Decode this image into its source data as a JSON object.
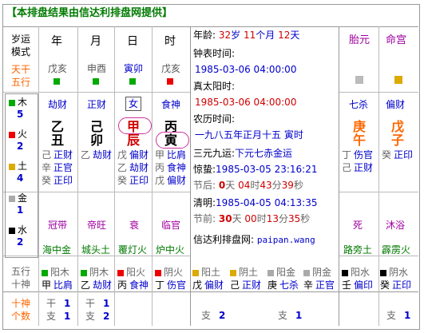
{
  "header": {
    "title": "【本排盘结果由信达利排盘网提供】"
  },
  "row_labels": {
    "yun": "岁运模式",
    "tiangan": "天干五行",
    "wuxing": [
      {
        "name": "木",
        "count": "5",
        "color": "#00aa00"
      },
      {
        "name": "火",
        "count": "2",
        "color": "#ee0000"
      },
      {
        "name": "土",
        "count": "4",
        "color": "#ddaa00"
      },
      {
        "name": "金",
        "count": "1",
        "color": "#aaaaaa"
      },
      {
        "name": "水",
        "count": "2",
        "color": "#000000"
      }
    ],
    "wuxing_shishen": "五行十神",
    "shishen_count": "十神个数"
  },
  "pillars": [
    {
      "header": "年",
      "ganzhi": "戊亥",
      "color": "#00aa00",
      "shishen": "劫财",
      "gan": "乙",
      "zhi": "丑",
      "cang": [
        [
          "己",
          "正财"
        ],
        [
          "辛",
          "正官"
        ],
        [
          "癸",
          "正印"
        ]
      ],
      "state": "冠带",
      "nayin": "海中金",
      "wx_sq": "#00aa00",
      "wx_text": "阳木",
      "wx_ss": "比肩",
      "count": [
        "干",
        "1",
        "支",
        "1"
      ]
    },
    {
      "header": "月",
      "ganzhi": "申酉",
      "color": "#00aa00",
      "shishen": "正财",
      "gan": "己",
      "zhi": "卯",
      "cang": [
        [
          "乙",
          "劫财"
        ]
      ],
      "state": "帝旺",
      "nayin": "城头土",
      "wx_sq": "#00aa00",
      "wx_text": "阴木",
      "wx_ss": "劫财",
      "count": [
        "干",
        "1",
        "支",
        "2"
      ]
    },
    {
      "header": "日",
      "ganzhi": "寅卯",
      "color": "#00aa00",
      "shishen": "女",
      "gan": "甲",
      "zhi": "辰",
      "cang": [
        [
          "戊",
          "偏财"
        ],
        [
          "乙",
          "劫财"
        ],
        [
          "癸",
          "正印"
        ]
      ],
      "state": "衰",
      "nayin": "覆灯火",
      "wx_sq": "#ee0000",
      "wx_text": "阳火",
      "wx_ss": "食神",
      "count": [
        "干",
        "",
        "",
        " "
      ]
    },
    {
      "header": "时",
      "ganzhi": "戊亥",
      "color": "#ee0000",
      "shishen": "食神",
      "gan": "丙",
      "zhi": "寅",
      "cang": [
        [
          "甲",
          "比肩"
        ],
        [
          "丙",
          "食神"
        ],
        [
          "戊",
          "偏财"
        ]
      ],
      "state": "临官",
      "nayin": "炉中火",
      "wx_sq": "#ee0000",
      "wx_text": "阴火",
      "wx_ss": "伤官",
      "count": [
        "干",
        "",
        "",
        " "
      ]
    }
  ],
  "info": {
    "age_label": "年龄:",
    "age_year": "32",
    "age_year_unit": "岁",
    "age_month": "11",
    "age_month_unit": "个月",
    "age_day": "12",
    "age_day_unit": "天",
    "clock_label": "钟表时间:",
    "clock_value": "1985-03-06 04:00:00",
    "solar_label": "真太阳时:",
    "solar_value": "1985-03-06 04:00:00",
    "lunar_label": "农历时间:",
    "lunar_value": "一九八五年正月十五 寅时",
    "sanyuan_label": "三元九运:",
    "sanyuan_value": "下元七赤金运",
    "jingzhe_label": "惊蛰:",
    "jingzhe_value": "1985-03-05 23:16:21",
    "jieqian_label": "节后:",
    "jieqian_d": "0",
    "jieqian_d_unit": "天",
    "jieqian_h": "04",
    "jieqian_h_unit": "时",
    "jieqian_m": "43",
    "jieqian_m_unit": "分",
    "jieqian_s": "39",
    "jieqian_s_unit": "秒",
    "qingming_label": "清明:",
    "qingming_value": "1985-04-05 04:13:35",
    "jiehou_label": "节前:",
    "jiehou_d": "30",
    "jiehou_d_unit": "天",
    "jiehou_h": "00",
    "jiehou_h_unit": "时",
    "jiehou_m": "13",
    "jiehou_m_unit": "分",
    "jiehou_s": "35",
    "jiehou_s_unit": "秒",
    "site_label": "信达利排盘网:",
    "site_value": "paipan.wang"
  },
  "right": {
    "taiyuan_header": "胎元",
    "minggong_header": "命宫",
    "taiyuan_ss": "七杀",
    "minggong_ss": "偏财",
    "taiyuan_gan": "庚",
    "taiyuan_zhi": "午",
    "minggong_gan": "戊",
    "minggong_zhi": "子",
    "taiyuan_cang": [
      [
        "丁",
        "伤官"
      ],
      [
        "己",
        "正财"
      ]
    ],
    "minggong_cang": [
      [
        "癸",
        "正印"
      ]
    ],
    "taiyuan_state": "死",
    "minggong_state": "沐浴",
    "taiyuan_nayin": "路旁土",
    "minggong_nayin": "霹雳火"
  },
  "bottom_extra": [
    {
      "sq": "#ddaa00",
      "t1": "阳土",
      "g": "戊",
      "s": "偏财"
    },
    {
      "sq": "#ddaa00",
      "t1": "阴土",
      "g": "己",
      "s": "正财"
    },
    {
      "sq": "#aaaaaa",
      "t1": "阳金",
      "g": "庚",
      "s": "七杀"
    },
    {
      "sq": "#aaaaaa",
      "t1": "阴金",
      "g": "辛",
      "s": "正官"
    },
    {
      "sq": "#000000",
      "t1": "阳水",
      "g": "壬",
      "s": "偏印"
    },
    {
      "sq": "#000000",
      "t1": "阴水",
      "g": "癸",
      "s": "正印"
    }
  ],
  "bottom_counts": [
    {
      "l": "支",
      "v": "2"
    },
    {
      "l": "支",
      "v": "1"
    },
    {
      "l": "支",
      "v": "1"
    }
  ]
}
